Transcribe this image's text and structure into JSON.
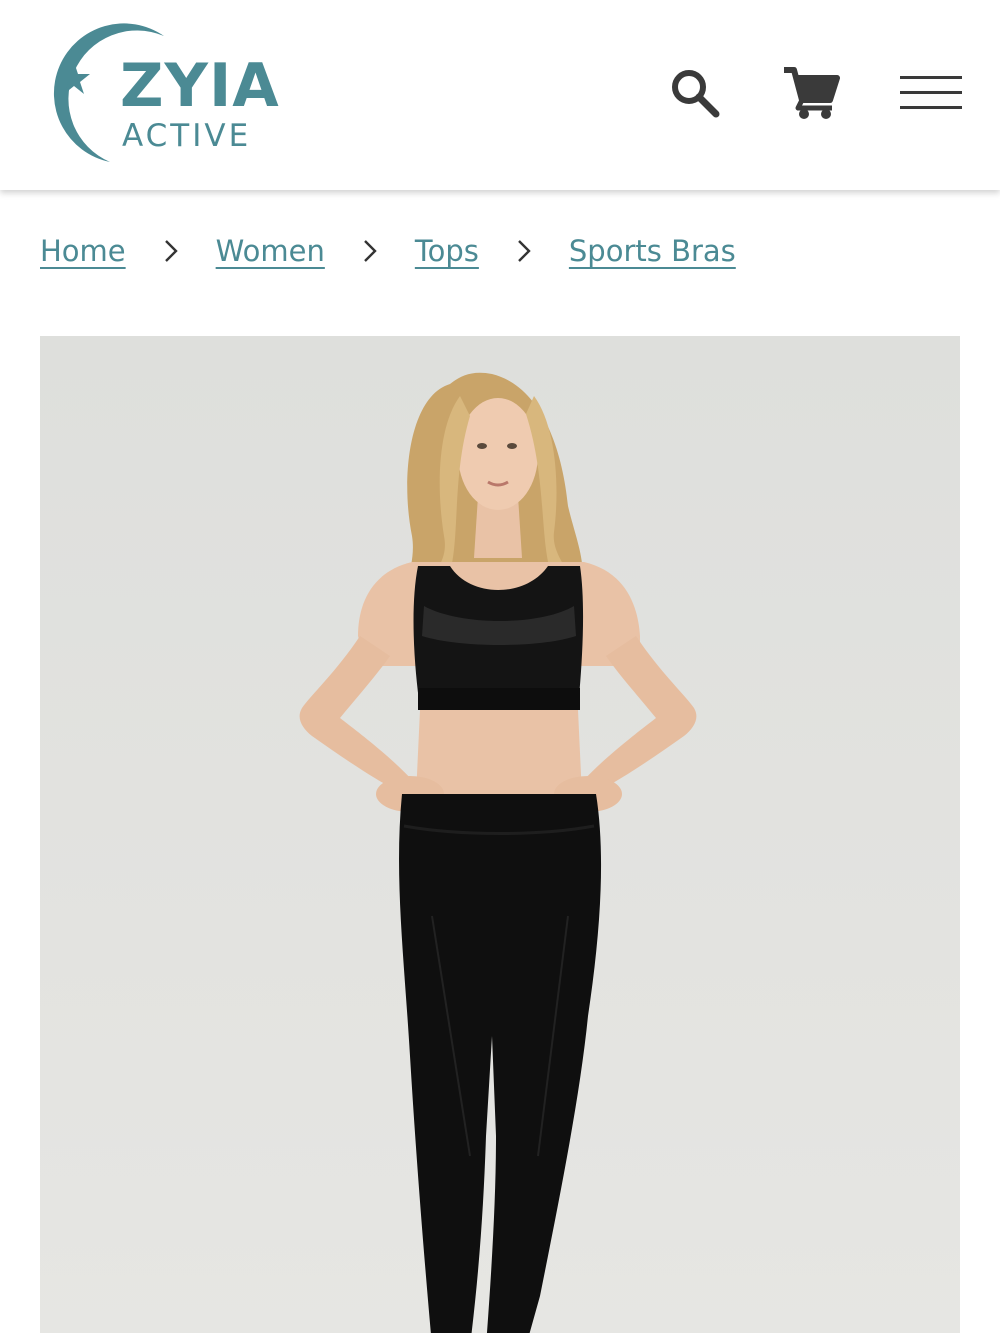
{
  "header": {
    "logo": {
      "word": "ZYIA",
      "subword": "ACTIVE",
      "icon": "crescent-star-logo"
    },
    "icons": {
      "search": "search-icon",
      "cart": "cart-icon",
      "menu": "hamburger-menu-icon"
    }
  },
  "breadcrumb": {
    "items": [
      {
        "label": "Home"
      },
      {
        "label": "Women"
      },
      {
        "label": "Tops"
      },
      {
        "label": "Sports Bras"
      }
    ],
    "separator_icon": "chevron-right-icon"
  },
  "colors": {
    "brand": "#4b8a94",
    "icon": "#3a3a3a",
    "image_bg": "#e0e0dd",
    "garment": "#111111"
  }
}
